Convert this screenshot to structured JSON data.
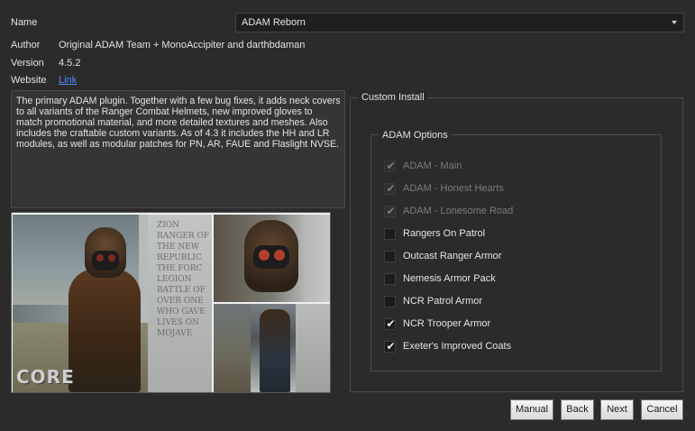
{
  "info": {
    "name_label": "Name",
    "name_value": "ADAM Reborn",
    "author_label": "Author",
    "author_value": "Original ADAM Team + MonoAccipiter and darthbdaman",
    "version_label": "Version",
    "version_value": "4.5.2",
    "website_label": "Website",
    "website_link": "Link"
  },
  "description": "The primary ADAM plugin. Together with a few bug fixes, it adds neck covers to all variants of the Ranger Combat Helmets, new improved gloves to match promotional material, and more detailed textures and meshes. Also includes the craftable custom variants. As of 4.3 it includes the HH and LR modules, as well as modular patches for PN, AR, FAUE and Flaslight NVSE.",
  "preview": {
    "logo_text": "CORE",
    "monument_text": "ZION RANGER OF THE NEW REPUBLIC THE FORC LEGION BATTLE OF OVER ONE WHO GAVE LIVES ON MOJAVE"
  },
  "custom_install": {
    "title": "Custom Install",
    "group_title": "ADAM Options",
    "options": [
      {
        "label": "ADAM - Main",
        "checked": true,
        "disabled": true
      },
      {
        "label": "ADAM - Honest Hearts",
        "checked": true,
        "disabled": true
      },
      {
        "label": "ADAM - Lonesome Road",
        "checked": true,
        "disabled": true
      },
      {
        "label": "Rangers On Patrol",
        "checked": false,
        "disabled": false
      },
      {
        "label": "Outcast Ranger Armor",
        "checked": false,
        "disabled": false
      },
      {
        "label": "Nemesis Armor Pack",
        "checked": false,
        "disabled": false
      },
      {
        "label": "NCR Patrol Armor",
        "checked": false,
        "disabled": false
      },
      {
        "label": "NCR Trooper Armor",
        "checked": true,
        "disabled": false
      },
      {
        "label": "Exeter's Improved Coats",
        "checked": true,
        "disabled": false
      }
    ]
  },
  "buttons": {
    "manual": "Manual",
    "back": "Back",
    "next": "Next",
    "cancel": "Cancel"
  },
  "colors": {
    "background": "#2b2b2b",
    "link": "#4d8cff"
  },
  "icons": {
    "dropdown": "chevron-down-icon",
    "check": "check-icon"
  }
}
